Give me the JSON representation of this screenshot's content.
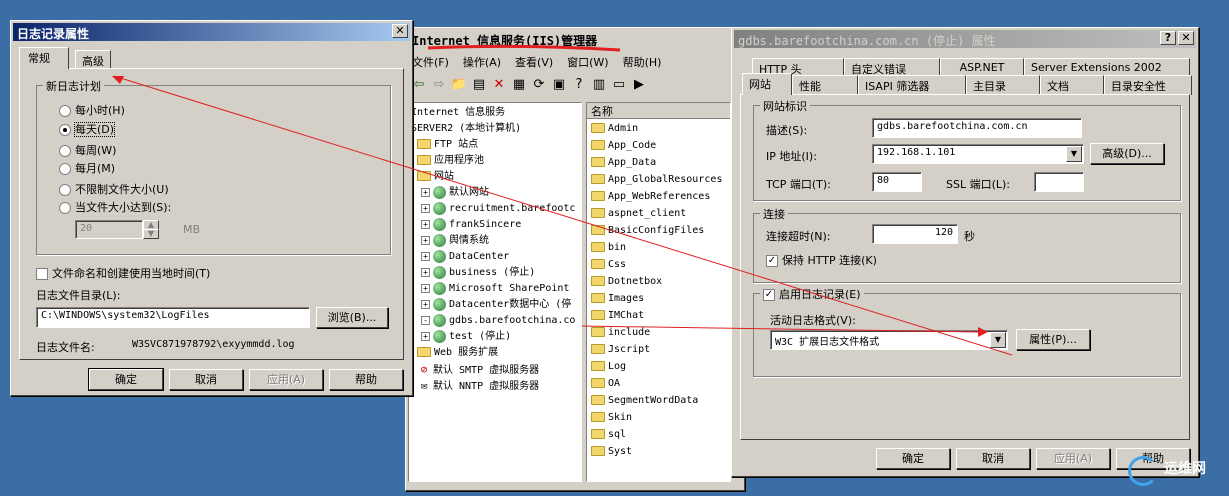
{
  "log_dialog": {
    "title": "日志记录属性",
    "close": "✕",
    "tabs": [
      "常规",
      "高级"
    ],
    "group_label": "新日志计划",
    "options": [
      "每小时(H)",
      "每天(D)",
      "每周(W)",
      "每月(M)",
      "不限制文件大小(U)",
      "当文件大小达到(S):"
    ],
    "size_value": "20",
    "size_unit": "MB",
    "local_time_label": "文件命名和创建使用当地时间(T)",
    "dir_label": "日志文件目录(L):",
    "dir_value": "C:\\WINDOWS\\system32\\LogFiles",
    "browse": "浏览(B)...",
    "filename_label": "日志文件名:",
    "filename_value": "W3SVC871978792\\exyymmdd.log",
    "ok": "确定",
    "cancel": "取消",
    "apply": "应用(A)",
    "help": "帮助"
  },
  "iis": {
    "title": "Internet 信息服务(IIS)管理器",
    "menu": [
      "文件(F)",
      "操作(A)",
      "查看(V)",
      "窗口(W)",
      "帮助(H)"
    ],
    "tree": [
      "Internet 信息服务",
      "SERVER2 (本地计算机)",
      "FTP 站点",
      "应用程序池",
      "网站",
      "默认网站",
      "recruitment.barefootc",
      "frankSincere",
      "舆情系统",
      "DataCenter",
      "business (停止)",
      "Microsoft SharePoint",
      "Datacenter数据中心 (停",
      "gdbs.barefootchina.co",
      "test (停止)",
      "Web 服务扩展",
      "默认 SMTP 虚拟服务器",
      "默认 NNTP 虚拟服务器"
    ],
    "list_header": "名称",
    "folders": [
      "Admin",
      "App_Code",
      "App_Data",
      "App_GlobalResources",
      "App_WebReferences",
      "aspnet_client",
      "BasicConfigFiles",
      "bin",
      "Css",
      "Dotnetbox",
      "Images",
      "IMChat",
      "include",
      "Jscript",
      "Log",
      "OA",
      "SegmentWordData",
      "Skin",
      "sql",
      "Syst"
    ]
  },
  "props": {
    "title": "gdbs.barefootchina.com.cn (停止) 属性",
    "help_btn": "?",
    "close": "✕",
    "tabs_back": [
      "HTTP 头",
      "自定义错误",
      "ASP.NET",
      "Server Extensions 2002"
    ],
    "tabs_front": [
      "网站",
      "性能",
      "ISAPI 筛选器",
      "主目录",
      "文档",
      "目录安全性"
    ],
    "site_group": "网站标识",
    "desc_label": "描述(S):",
    "desc_value": "gdbs.barefootchina.com.cn",
    "ip_label": "IP 地址(I):",
    "ip_value": "192.168.1.101",
    "advanced": "高级(D)...",
    "tcp_label": "TCP 端口(T):",
    "tcp_value": "80",
    "ssl_label": "SSL 端口(L):",
    "ssl_value": "",
    "conn_group": "连接",
    "timeout_label": "连接超时(N):",
    "timeout_value": "120",
    "seconds": "秒",
    "keepalive": "保持 HTTP 连接(K)",
    "enable_log": "启用日志记录(E)",
    "format_label": "活动日志格式(V):",
    "format_value": "W3C 扩展日志文件格式",
    "properties": "属性(P)...",
    "ok": "确定",
    "cancel": "取消",
    "apply": "应用(A)",
    "help": "帮助"
  },
  "watermark": "运维网"
}
